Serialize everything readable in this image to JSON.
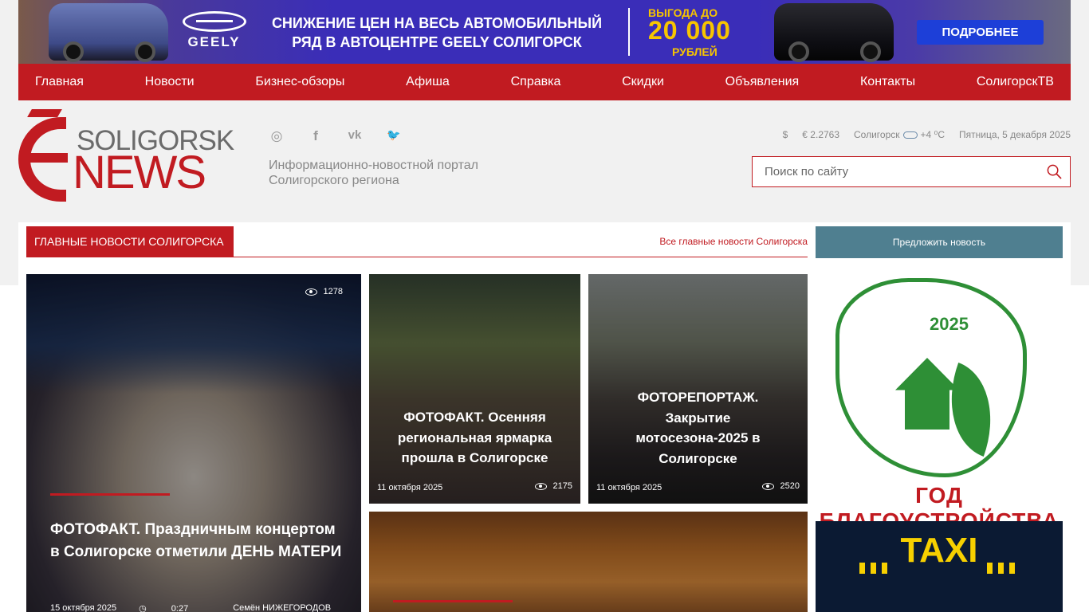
{
  "banner": {
    "brand": "GEELY",
    "headline": "СНИЖЕНИЕ ЦЕН НА ВЕСЬ АВТОМОБИЛЬНЫЙ РЯД В АВТОЦЕНТРЕ GEELY СОЛИГОРСК",
    "promo_top": "ВЫГОДА ДО",
    "promo_amount": "20 000",
    "promo_bottom": "РУБЛЕЙ",
    "button": "ПОДРОБНЕЕ",
    "colors": {
      "background": "#3a2db8",
      "accent": "#f7c500",
      "button": "#1d3fd8"
    }
  },
  "nav": {
    "items": [
      {
        "label": "Главная"
      },
      {
        "label": "Новости"
      },
      {
        "label": "Бизнес-обзоры"
      },
      {
        "label": "Афиша"
      },
      {
        "label": "Справка"
      },
      {
        "label": "Скидки"
      },
      {
        "label": "Объявления"
      },
      {
        "label": "Контакты"
      },
      {
        "label": "СолигорскТВ"
      }
    ],
    "color": "#c11b21"
  },
  "logo": {
    "line1": "SOLIGORSK",
    "line2": "NEWS"
  },
  "social": {
    "icons": [
      "instagram-icon",
      "facebook-icon",
      "vk-icon",
      "twitter-icon"
    ],
    "glyphs": [
      "◎",
      "f",
      "vk",
      "🐦"
    ]
  },
  "tagline": "Информационно-новостной портал Солигорского региона",
  "info": {
    "usd": "$",
    "eur": "€ 2.2763",
    "city": "Солигорск",
    "temp": "+4 ⁰С",
    "date": "Пятница, 5 декабря 2025"
  },
  "search": {
    "placeholder": "Поиск по сайту"
  },
  "section": {
    "title": "Главные новости Солигорска",
    "all_link": "Все главные новости Солигорска",
    "suggest": "Предложить новость"
  },
  "news": {
    "main": {
      "title": "ФОТОФАКТ. Праздничным концертом в Солигорске отметили ДЕНЬ МАТЕРИ",
      "views": "1278",
      "date": "15 октября 2025",
      "duration": "0:27",
      "author": "Семён НИЖЕГОРОДОВ"
    },
    "second": {
      "title": "ФОТОФАКТ. Осенняя региональная ярмарка прошла в Солигорске",
      "date": "11 октября 2025",
      "views": "2175"
    },
    "third": {
      "title": "ФОТОРЕПОРТАЖ. Закрытие мотосезона-2025 в Солигорске",
      "date": "11 октября 2025",
      "views": "2520"
    }
  },
  "ads": {
    "ad1": {
      "year": "2025",
      "caption": "ГОД БЛАГОУСТРОЙСТВА",
      "color": "#2e8f36"
    },
    "ad2": {
      "text": "TAXI"
    }
  }
}
